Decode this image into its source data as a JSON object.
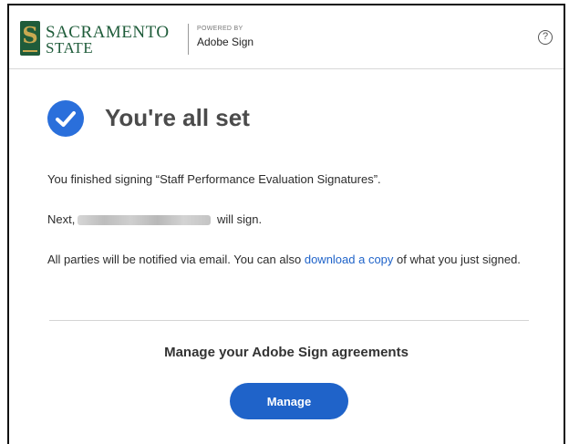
{
  "header": {
    "logo_line1": "SACRAMENTO",
    "logo_line2": "STATE",
    "powered_by": "POWERED BY",
    "product": "Adobe Sign",
    "help_icon": "question-circle-icon"
  },
  "status": {
    "icon": "checkmark-circle-icon",
    "title": "You're all set"
  },
  "messages": {
    "finished_prefix": "You finished signing “Staff Performance Evaluation Signatures”.",
    "next_prefix": "Next,",
    "next_suffix": "will sign.",
    "notify_text": "All parties will be notified via email. You can also",
    "download_link": "download a copy",
    "notify_suffix": "of what you just signed."
  },
  "manage": {
    "heading": "Manage your Adobe Sign agreements",
    "button_label": "Manage"
  },
  "colors": {
    "brand_green": "#1f5c3a",
    "brand_gold": "#c8a951",
    "accent_blue": "#1f63c9",
    "check_blue": "#2a6fdb"
  }
}
